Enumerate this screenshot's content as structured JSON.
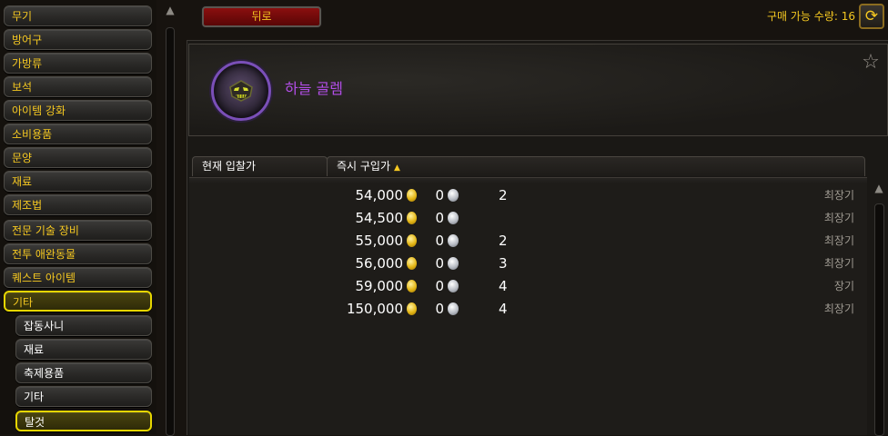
{
  "sidebar": {
    "categories": [
      {
        "label": "무기"
      },
      {
        "label": "방어구"
      },
      {
        "label": "가방류"
      },
      {
        "label": "보석"
      },
      {
        "label": "아이템 강화"
      },
      {
        "label": "소비용품"
      },
      {
        "label": "문양"
      },
      {
        "label": "재료"
      },
      {
        "label": "제조법"
      },
      {
        "label": "전문 기술 장비"
      },
      {
        "label": "전투 애완동물"
      },
      {
        "label": "퀘스트 아이템"
      },
      {
        "label": "기타",
        "selected": true
      }
    ],
    "subcategories": [
      {
        "label": "잡동사니"
      },
      {
        "label": "재료"
      },
      {
        "label": "축제용품"
      },
      {
        "label": "기타"
      },
      {
        "label": "탈것",
        "selected": true
      }
    ]
  },
  "toolbar": {
    "back_label": "뒤로",
    "purchase_qty_label": "구매 가능 수량: 16",
    "refresh_icon": "refresh-icon"
  },
  "item": {
    "name": "하늘 골렘",
    "name_color": "#b34ee8",
    "icon": "mount-golem-icon",
    "favorite_icon": "star-outline-icon"
  },
  "columns": {
    "current_bid": "현재 입찰가",
    "buyout": "즉시 구입가"
  },
  "listings": [
    {
      "gold": "54,000",
      "silver": "0",
      "qty": "2",
      "duration": "최장기"
    },
    {
      "gold": "54,500",
      "silver": "0",
      "qty": "",
      "duration": "최장기"
    },
    {
      "gold": "55,000",
      "silver": "0",
      "qty": "2",
      "duration": "최장기"
    },
    {
      "gold": "56,000",
      "silver": "0",
      "qty": "3",
      "duration": "최장기"
    },
    {
      "gold": "59,000",
      "silver": "0",
      "qty": "4",
      "duration": "장기"
    },
    {
      "gold": "150,000",
      "silver": "0",
      "qty": "4",
      "duration": "최장기"
    }
  ],
  "colors": {
    "accent_gold": "#f5c821",
    "back_button_red": "#8a0f0f",
    "selected_border": "#e6d600"
  }
}
